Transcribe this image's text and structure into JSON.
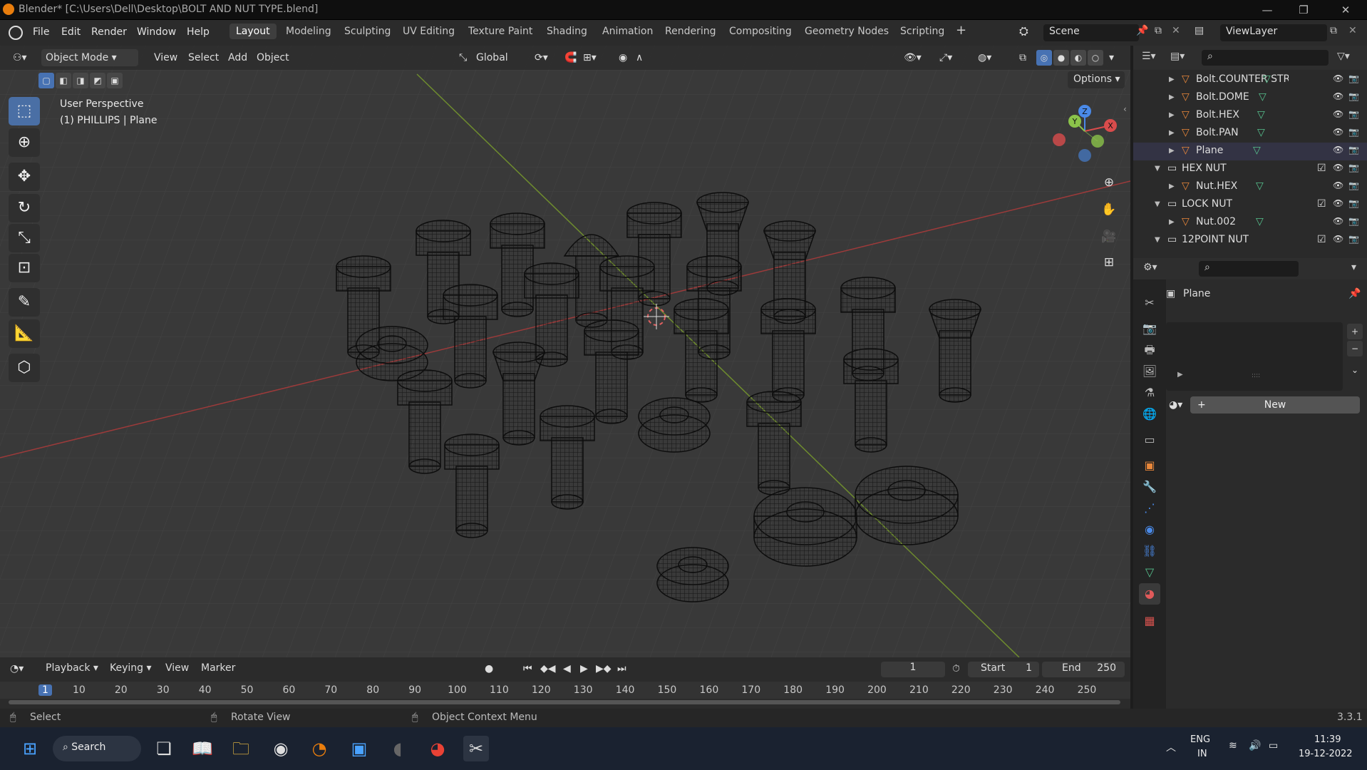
{
  "window": {
    "title": "Blender* [C:\\Users\\Dell\\Desktop\\BOLT AND NUT TYPE.blend]"
  },
  "menu": {
    "items": [
      "File",
      "Edit",
      "Render",
      "Window",
      "Help"
    ]
  },
  "workspaces": [
    "Layout",
    "Modeling",
    "Sculpting",
    "UV Editing",
    "Texture Paint",
    "Shading",
    "Animation",
    "Rendering",
    "Compositing",
    "Geometry Nodes",
    "Scripting"
  ],
  "scene": {
    "name": "Scene",
    "view_layer": "ViewLayer"
  },
  "viewport": {
    "mode": "Object Mode",
    "menus": [
      "View",
      "Select",
      "Add",
      "Object"
    ],
    "orientation": "Global",
    "options_label": "Options",
    "overlay_view": "User Perspective",
    "overlay_object": "(1) PHILLIPS | Plane",
    "gizmo_axes": {
      "x": "X",
      "y": "Y",
      "z": "Z"
    }
  },
  "outliner": {
    "rows": [
      {
        "name": "Bolt.COUNTER STRIKE",
        "type": "mesh",
        "indent": 2
      },
      {
        "name": "Bolt.DOME",
        "type": "mesh",
        "indent": 2
      },
      {
        "name": "Bolt.HEX",
        "type": "mesh",
        "indent": 2
      },
      {
        "name": "Bolt.PAN",
        "type": "mesh",
        "indent": 2
      },
      {
        "name": "Plane",
        "type": "mesh",
        "indent": 2
      },
      {
        "name": "HEX NUT",
        "type": "collection",
        "indent": 1
      },
      {
        "name": "Nut.HEX",
        "type": "mesh",
        "indent": 2
      },
      {
        "name": "LOCK NUT",
        "type": "collection",
        "indent": 1
      },
      {
        "name": "Nut.002",
        "type": "mesh",
        "indent": 2
      },
      {
        "name": "12POINT NUT",
        "type": "collection",
        "indent": 1
      }
    ]
  },
  "properties": {
    "object_name": "Plane",
    "new_button": "New"
  },
  "timeline": {
    "menus": [
      "Playback",
      "Keying",
      "View",
      "Marker"
    ],
    "current_frame": "1",
    "start_label": "Start",
    "start": "1",
    "end_label": "End",
    "end": "250",
    "ruler": [
      "1",
      "10",
      "20",
      "30",
      "40",
      "50",
      "60",
      "70",
      "80",
      "90",
      "100",
      "110",
      "120",
      "130",
      "140",
      "150",
      "160",
      "170",
      "180",
      "190",
      "200",
      "210",
      "220",
      "230",
      "240",
      "250"
    ]
  },
  "statusbar": {
    "select": "Select",
    "rotate": "Rotate View",
    "context": "Object Context Menu",
    "version": "3.3.1"
  },
  "taskbar": {
    "search": "Search",
    "lang1": "ENG",
    "lang2": "IN",
    "time": "11:39",
    "date": "19-12-2022"
  },
  "colors": {
    "accent": "#4772b3",
    "mesh_icon": "#e8873a",
    "x_axis": "#d94c4c",
    "y_axis": "#8bc34a",
    "z_axis": "#4a8ae8"
  }
}
